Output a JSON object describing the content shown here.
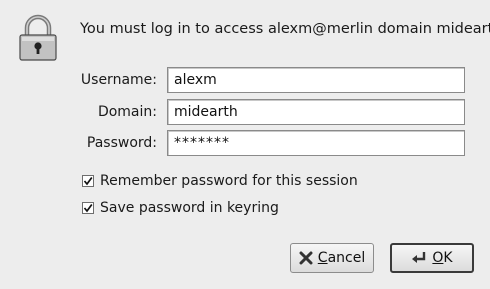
{
  "dialog": {
    "message": "You must log in to access alexm@merlin domain midearth",
    "icon": "lock-icon"
  },
  "fields": {
    "username": {
      "label": "Username:",
      "value": "alexm"
    },
    "domain": {
      "label": "Domain:",
      "value": "midearth"
    },
    "password": {
      "label": "Password:",
      "value": "*******"
    }
  },
  "options": {
    "remember_session": {
      "label": "Remember password for this session",
      "checked": true
    },
    "save_keyring": {
      "label": "Save password in keyring",
      "checked": true
    }
  },
  "buttons": {
    "cancel": "Cancel",
    "ok": "OK"
  }
}
